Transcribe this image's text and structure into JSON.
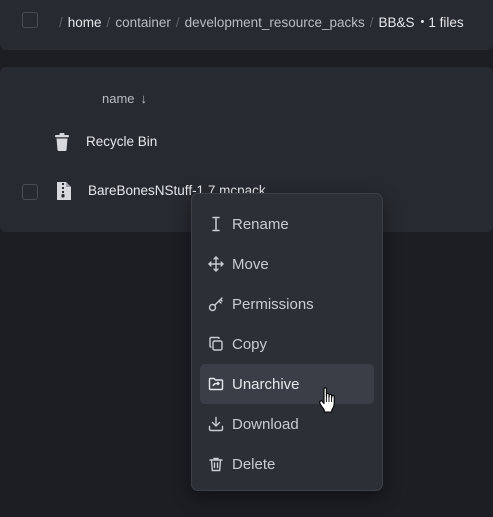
{
  "breadcrumb": {
    "items": [
      "home",
      "container",
      "development_resource_packs",
      "BB&S"
    ],
    "dot": "•",
    "count": "1 files"
  },
  "list": {
    "column_name": "name",
    "sort_arrow": "↓",
    "rows": [
      {
        "label": "Recycle Bin",
        "icon": "trash-icon"
      },
      {
        "label": "BareBonesNStuff-1.7.mcpack",
        "icon": "file-zip-icon"
      }
    ]
  },
  "menu": {
    "items": [
      {
        "label": "Rename",
        "icon": "text-cursor-icon"
      },
      {
        "label": "Move",
        "icon": "move-arrows-icon"
      },
      {
        "label": "Permissions",
        "icon": "key-icon"
      },
      {
        "label": "Copy",
        "icon": "copy-icon"
      },
      {
        "label": "Unarchive",
        "icon": "folder-open-icon",
        "hovered": true
      },
      {
        "label": "Download",
        "icon": "download-icon"
      },
      {
        "label": "Delete",
        "icon": "trash-icon"
      }
    ]
  },
  "colors": {
    "background": "#1d1e24",
    "card": "#282a31",
    "menu": "#2d2f37",
    "menu_hover": "#3b3e47"
  }
}
